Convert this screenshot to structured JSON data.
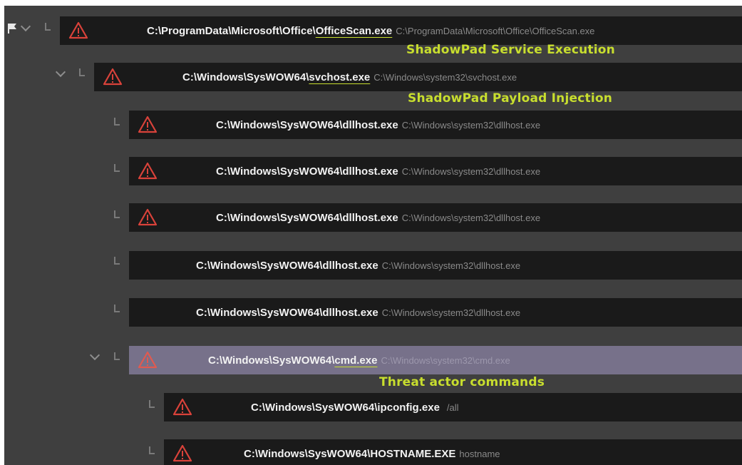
{
  "rows": [
    {
      "dir": "C:\\ProgramData\\Microsoft\\Office\\",
      "exe": "OfficeScan.exe",
      "cmd": "C:\\ProgramData\\Microsoft\\Office\\OfficeScan.exe",
      "annotation": "ShadowPad Service Execution"
    },
    {
      "dir": "C:\\Windows\\SysWOW64\\",
      "exe": "svchost.exe",
      "cmd": "C:\\Windows\\system32\\svchost.exe",
      "annotation": "ShadowPad Payload Injection"
    },
    {
      "dir": "C:\\Windows\\SysWOW64\\",
      "exe": "dllhost.exe",
      "cmd": "C:\\Windows\\system32\\dllhost.exe"
    },
    {
      "dir": "C:\\Windows\\SysWOW64\\",
      "exe": "dllhost.exe",
      "cmd": "C:\\Windows\\system32\\dllhost.exe"
    },
    {
      "dir": "C:\\Windows\\SysWOW64\\",
      "exe": "dllhost.exe",
      "cmd": "C:\\Windows\\system32\\dllhost.exe"
    },
    {
      "dir": "C:\\Windows\\SysWOW64\\",
      "exe": "dllhost.exe",
      "cmd": "C:\\Windows\\system32\\dllhost.exe"
    },
    {
      "dir": "C:\\Windows\\SysWOW64\\",
      "exe": "dllhost.exe",
      "cmd": "C:\\Windows\\system32\\dllhost.exe"
    },
    {
      "dir": "C:\\Windows\\SysWOW64\\",
      "exe": "cmd.exe",
      "cmd": "C:\\Windows\\system32\\cmd.exe",
      "annotation": "Threat actor commands"
    },
    {
      "dir": "C:\\Windows\\SysWOW64\\",
      "exe": "ipconfig.exe",
      "cmd": "/all"
    },
    {
      "dir": "C:\\Windows\\SysWOW64\\",
      "exe": "HOSTNAME.EXE",
      "cmd": "hostname"
    }
  ],
  "colors": {
    "annotation": "#c8de2e",
    "alert": "#d9423a",
    "row_bg": "#1a1a1a",
    "selected_bg": "#77718a",
    "panel_bg": "#3f3f3f"
  },
  "icons": {
    "alert": "warning-triangle-icon",
    "expand": "chevron-down-icon",
    "tree": "tree-elbow-icon",
    "flag": "flag-icon"
  }
}
